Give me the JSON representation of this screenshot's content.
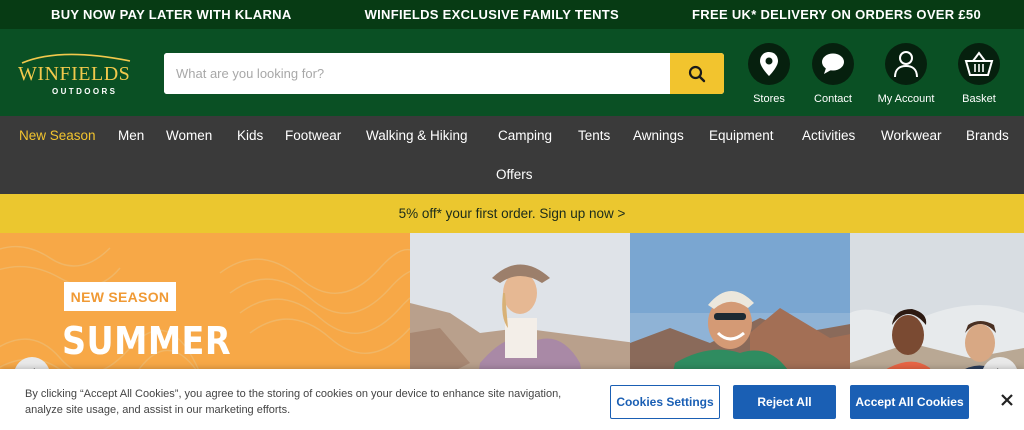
{
  "promo_bar": {
    "left": "BUY NOW PAY LATER WITH KLARNA",
    "center": "WINFIELDS EXCLUSIVE FAMILY TENTS",
    "right": "FREE UK* DELIVERY ON ORDERS OVER £50"
  },
  "header": {
    "logo_main": "WINFIELDS",
    "logo_sub": "OUTDOORS",
    "search_placeholder": "What are you looking for?",
    "icons": [
      {
        "label": "Stores",
        "icon": "map-pin-icon"
      },
      {
        "label": "Contact",
        "icon": "chat-bubble-icon"
      },
      {
        "label": "My Account",
        "icon": "user-icon"
      },
      {
        "label": "Basket",
        "icon": "basket-icon"
      }
    ]
  },
  "nav": {
    "items": [
      "New Season",
      "Men",
      "Women",
      "Kids",
      "Footwear",
      "Walking & Hiking",
      "Camping",
      "Tents",
      "Awnings",
      "Equipment",
      "Activities",
      "Workwear",
      "Brands"
    ],
    "offers": "Offers"
  },
  "signup_banner": "5% off* your first order. Sign up now >",
  "hero": {
    "badge": "NEW SEASON",
    "headline": "SUMMER"
  },
  "cookie": {
    "text": "By clicking “Accept All Cookies”, you agree to the storing of cookies on your device to enhance site navigation, analyze site usage, and assist in our marketing efforts.",
    "settings_label": "Cookies Settings",
    "reject_label": "Reject All",
    "accept_label": "Accept All Cookies"
  },
  "colors": {
    "promo_bg": "#073b14",
    "header_bg": "#0a5024",
    "nav_bg": "#3a3a3a",
    "accent_yellow": "#f2c42e",
    "hero_orange": "#f7a847",
    "button_blue": "#1a5fb4"
  }
}
